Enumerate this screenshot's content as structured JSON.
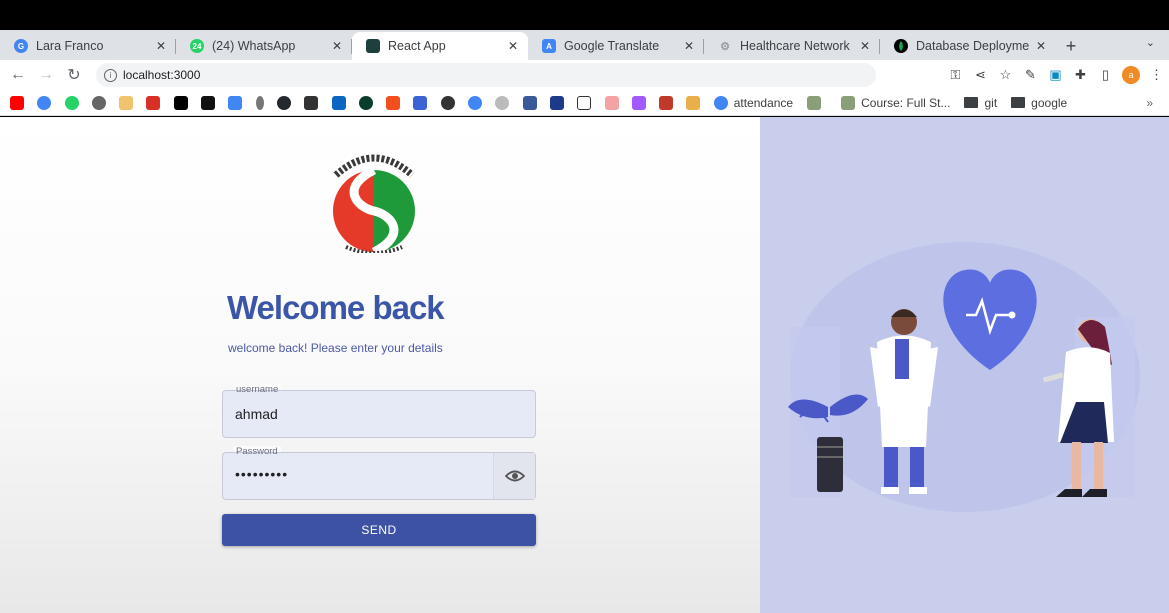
{
  "browser": {
    "tabs": [
      {
        "title": "Lara Franco",
        "favicon": "google-g-icon",
        "color": "#4285f4",
        "active": false
      },
      {
        "title": "(24) WhatsApp",
        "favicon": "whatsapp-icon",
        "color": "#25d366",
        "active": false
      },
      {
        "title": "React App",
        "favicon": "react-app-icon",
        "color": "#1f3f3f",
        "active": true
      },
      {
        "title": "Google Translate",
        "favicon": "translate-icon",
        "color": "#4285f4",
        "active": false
      },
      {
        "title": "Healthcare Network",
        "favicon": "gear-icon",
        "color": "#9aa0a6",
        "active": false
      },
      {
        "title": "Database Deployme",
        "favicon": "mongodb-leaf-icon",
        "color": "#13aa52",
        "active": false
      }
    ],
    "new_tab": "+",
    "tab_menu": "⌄",
    "url": "localhost:3000",
    "bookmarks": {
      "attendance": "attendance",
      "course": "Course: Full St...",
      "git": "git",
      "google": "google",
      "more": "»"
    },
    "avatar_letter": "a"
  },
  "login": {
    "title": "Welcome back",
    "subtitle": "welcome back! Please enter your details",
    "username_label": "username",
    "username_value": "ahmad",
    "password_label": "Password",
    "password_value": "•••••••••",
    "send_label": "SEND"
  },
  "colors": {
    "primary": "#3d52a4",
    "illustration_bg": "#c9ceec",
    "heart": "#5c6ee0"
  }
}
